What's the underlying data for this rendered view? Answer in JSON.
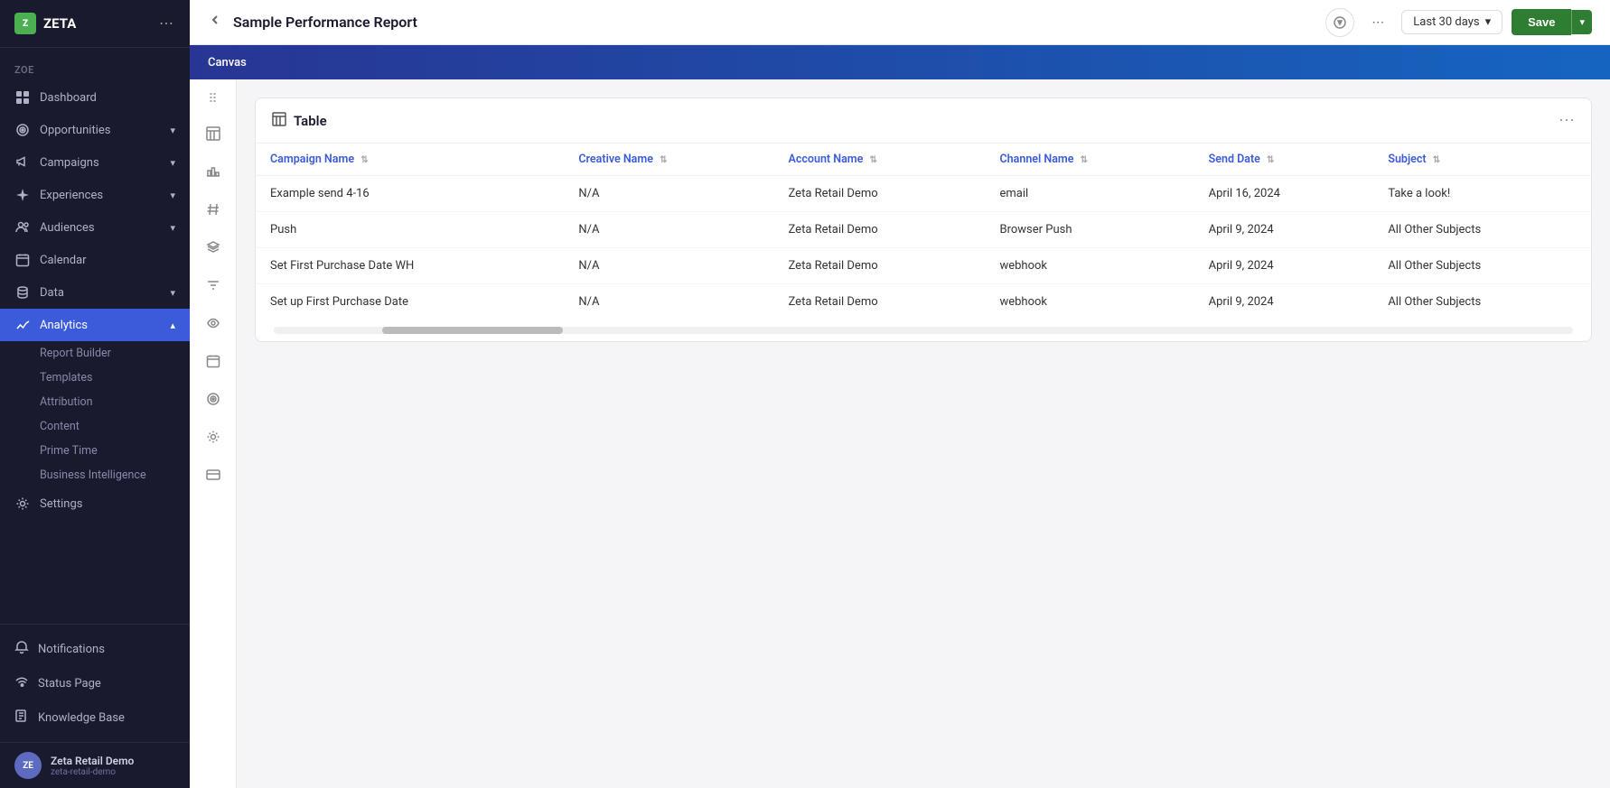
{
  "app": {
    "logo_text": "ZETA",
    "logo_abbr": "Z"
  },
  "sidebar": {
    "workspace": "ZOE",
    "more_icon": "⋯",
    "nav_items": [
      {
        "id": "dashboard",
        "label": "Dashboard",
        "icon": "grid"
      },
      {
        "id": "opportunities",
        "label": "Opportunities",
        "icon": "target",
        "has_chevron": true
      },
      {
        "id": "campaigns",
        "label": "Campaigns",
        "icon": "megaphone",
        "has_chevron": true
      },
      {
        "id": "experiences",
        "label": "Experiences",
        "icon": "sparkle",
        "has_chevron": true
      },
      {
        "id": "audiences",
        "label": "Audiences",
        "icon": "users",
        "has_chevron": true
      },
      {
        "id": "calendar",
        "label": "Calendar",
        "icon": "calendar"
      },
      {
        "id": "data",
        "label": "Data",
        "icon": "database",
        "has_chevron": true
      },
      {
        "id": "analytics",
        "label": "Analytics",
        "icon": "chart",
        "active": true,
        "has_chevron": true
      }
    ],
    "analytics_sub": [
      {
        "id": "report-builder",
        "label": "Report Builder"
      },
      {
        "id": "templates",
        "label": "Templates"
      },
      {
        "id": "attribution",
        "label": "Attribution"
      },
      {
        "id": "content",
        "label": "Content"
      },
      {
        "id": "prime-time",
        "label": "Prime Time"
      },
      {
        "id": "business-intelligence",
        "label": "Business Intelligence"
      }
    ],
    "bottom_items": [
      {
        "id": "settings",
        "label": "Settings",
        "icon": "gear"
      },
      {
        "id": "notifications",
        "label": "Notifications",
        "icon": "bell"
      },
      {
        "id": "status-page",
        "label": "Status Page",
        "icon": "wifi"
      },
      {
        "id": "knowledge-base",
        "label": "Knowledge Base",
        "icon": "book"
      }
    ],
    "user": {
      "name": "Zeta Retail Demo",
      "sub": "zeta-retail-demo",
      "initials": "ZE"
    }
  },
  "header": {
    "title": "Sample Performance Report",
    "date_range": "Last 30 days",
    "save_label": "Save",
    "back_icon": "←",
    "compass_icon": "⊙",
    "more_icon": "⋯",
    "chevron_down": "▾"
  },
  "canvas": {
    "label": "Canvas"
  },
  "toolbar": {
    "drag_icon": "⋮⋮",
    "icons": [
      {
        "id": "table-icon",
        "symbol": "▦"
      },
      {
        "id": "bar-chart-icon",
        "symbol": "▮"
      },
      {
        "id": "hash-icon",
        "symbol": "#"
      },
      {
        "id": "layers-icon",
        "symbol": "⊞"
      },
      {
        "id": "filter-icon",
        "symbol": "⊿"
      },
      {
        "id": "eye-icon",
        "symbol": "○"
      },
      {
        "id": "calendar-icon",
        "symbol": "▣"
      },
      {
        "id": "target-icon",
        "symbol": "◎"
      },
      {
        "id": "settings-icon",
        "symbol": "⚙"
      },
      {
        "id": "card-icon",
        "symbol": "▤"
      }
    ]
  },
  "table": {
    "title": "Table",
    "more_icon": "⋯",
    "columns": [
      {
        "id": "campaign-name",
        "label": "Campaign Name",
        "sortable": true
      },
      {
        "id": "creative-name",
        "label": "Creative Name",
        "sortable": true
      },
      {
        "id": "account-name",
        "label": "Account Name",
        "sortable": true
      },
      {
        "id": "channel-name",
        "label": "Channel Name",
        "sortable": true
      },
      {
        "id": "send-date",
        "label": "Send Date",
        "sortable": true
      },
      {
        "id": "subject",
        "label": "Subject",
        "sortable": true
      }
    ],
    "rows": [
      {
        "campaign_name": "Example send 4-16",
        "creative_name": "N/A",
        "account_name": "Zeta Retail Demo",
        "channel_name": "email",
        "send_date": "April 16, 2024",
        "subject": "Take a look!"
      },
      {
        "campaign_name": "Push",
        "creative_name": "N/A",
        "account_name": "Zeta Retail Demo",
        "channel_name": "Browser Push",
        "send_date": "April 9, 2024",
        "subject": "All Other Subjects"
      },
      {
        "campaign_name": "Set First Purchase Date WH",
        "creative_name": "N/A",
        "account_name": "Zeta Retail Demo",
        "channel_name": "webhook",
        "send_date": "April 9, 2024",
        "subject": "All Other Subjects"
      },
      {
        "campaign_name": "Set up First Purchase Date",
        "creative_name": "N/A",
        "account_name": "Zeta Retail Demo",
        "channel_name": "webhook",
        "send_date": "April 9, 2024",
        "subject": "All Other Subjects"
      }
    ]
  }
}
